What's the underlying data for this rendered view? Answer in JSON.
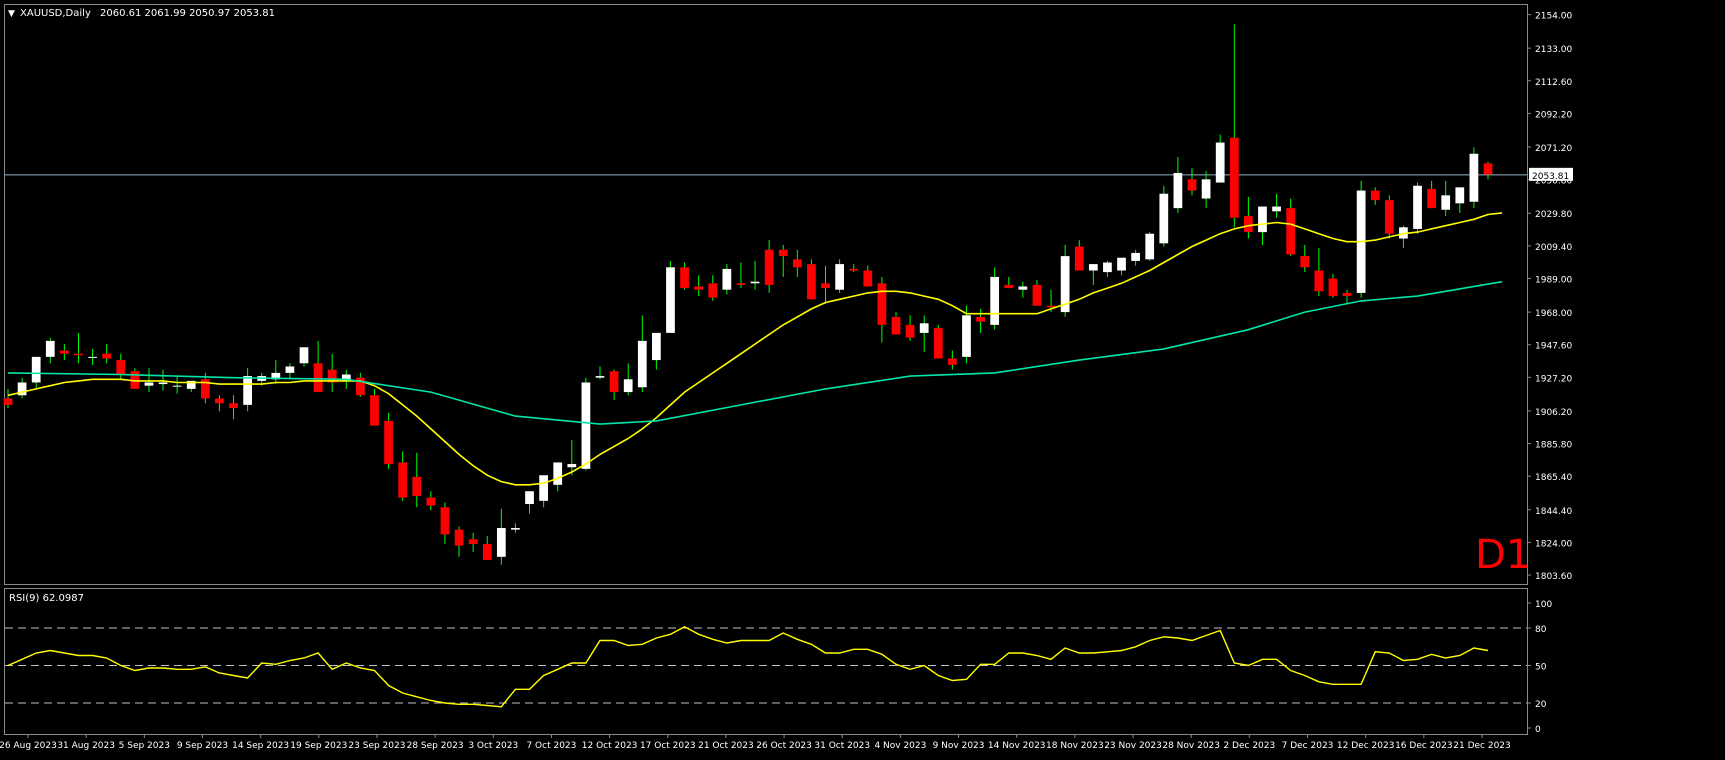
{
  "window": {
    "header_symbol": "XAUUSD,Daily",
    "header_ohlc": "2060.61 2061.99 2050.97 2053.81",
    "timeframe_badge": "D1"
  },
  "colors": {
    "background": "#000000",
    "bull_candle": "#ffffff",
    "bear_candle": "#ff0000",
    "wick": "#00ff00",
    "ma_fast": "#ffff00",
    "ma_slow": "#00e5a8",
    "rsi_line": "#ffff00",
    "price_line": "#8fb3c8",
    "badge": "#ff0000",
    "axis_text": "#ffffff"
  },
  "chart_data": [
    {
      "type": "candlestick",
      "symbol": "XAUUSD",
      "timeframe": "Daily",
      "current_price": 2053.81,
      "y_ticks": [
        "2154.00",
        "2133.00",
        "2112.60",
        "2092.20",
        "2071.20",
        "2050.80",
        "2029.80",
        "2009.40",
        "1989.00",
        "1968.00",
        "1947.60",
        "1927.20",
        "1906.20",
        "1885.80",
        "1865.40",
        "1844.40",
        "1824.00",
        "1803.60"
      ],
      "x_ticks": [
        "26 Aug 2023",
        "31 Aug 2023",
        "5 Sep 2023",
        "9 Sep 2023",
        "14 Sep 2023",
        "19 Sep 2023",
        "23 Sep 2023",
        "28 Sep 2023",
        "3 Oct 2023",
        "7 Oct 2023",
        "12 Oct 2023",
        "17 Oct 2023",
        "21 Oct 2023",
        "26 Oct 2023",
        "31 Oct 2023",
        "4 Nov 2023",
        "9 Nov 2023",
        "14 Nov 2023",
        "18 Nov 2023",
        "23 Nov 2023",
        "28 Nov 2023",
        "2 Dec 2023",
        "7 Dec 2023",
        "12 Dec 2023",
        "16 Dec 2023",
        "21 Dec 2023"
      ],
      "ylim": [
        1798,
        2160
      ],
      "ohlc": [
        [
          1914,
          1920,
          1908,
          1910
        ],
        [
          1916,
          1927,
          1914,
          1924
        ],
        [
          1924,
          1940,
          1920,
          1940
        ],
        [
          1940,
          1952,
          1936,
          1950
        ],
        [
          1944,
          1948,
          1938,
          1942
        ],
        [
          1942,
          1955,
          1936,
          1941
        ],
        [
          1940,
          1945,
          1935,
          1940
        ],
        [
          1942,
          1948,
          1936,
          1939
        ],
        [
          1938,
          1942,
          1926,
          1929
        ],
        [
          1931,
          1933,
          1920,
          1920
        ],
        [
          1922,
          1933,
          1918,
          1924
        ],
        [
          1923,
          1932,
          1919,
          1924
        ],
        [
          1922,
          1928,
          1917,
          1922
        ],
        [
          1920,
          1924,
          1918,
          1925
        ],
        [
          1926,
          1930,
          1911,
          1914
        ],
        [
          1914,
          1916,
          1906,
          1911
        ],
        [
          1911,
          1916,
          1901,
          1908
        ],
        [
          1910,
          1933,
          1906,
          1928
        ],
        [
          1925,
          1930,
          1922,
          1928
        ],
        [
          1926,
          1938,
          1923,
          1930
        ],
        [
          1930,
          1936,
          1926,
          1934
        ],
        [
          1936,
          1945,
          1934,
          1946
        ],
        [
          1936,
          1950,
          1918,
          1918
        ],
        [
          1932,
          1942,
          1918,
          1924
        ],
        [
          1925,
          1932,
          1920,
          1929
        ],
        [
          1927,
          1930,
          1915,
          1916
        ],
        [
          1916,
          1920,
          1897,
          1897
        ],
        [
          1900,
          1905,
          1870,
          1873
        ],
        [
          1874,
          1881,
          1850,
          1852
        ],
        [
          1865,
          1880,
          1846,
          1853
        ],
        [
          1852,
          1856,
          1844,
          1847
        ],
        [
          1846,
          1849,
          1823,
          1829
        ],
        [
          1832,
          1834,
          1815,
          1822
        ],
        [
          1826,
          1830,
          1818,
          1823
        ],
        [
          1823,
          1828,
          1815,
          1813
        ],
        [
          1815,
          1845,
          1810,
          1833
        ],
        [
          1832,
          1836,
          1830,
          1833
        ],
        [
          1848,
          1854,
          1842,
          1856
        ],
        [
          1850,
          1859,
          1846,
          1866
        ],
        [
          1860,
          1872,
          1856,
          1874
        ],
        [
          1871,
          1888,
          1866,
          1873
        ],
        [
          1870,
          1927,
          1869,
          1924
        ],
        [
          1927,
          1934,
          1926,
          1928
        ],
        [
          1931,
          1932,
          1913,
          1918
        ],
        [
          1918,
          1936,
          1916,
          1926
        ],
        [
          1921,
          1966,
          1918,
          1950
        ],
        [
          1938,
          1955,
          1932,
          1955
        ],
        [
          1955,
          2000,
          1955,
          1996
        ],
        [
          1996,
          1999,
          1982,
          1983
        ],
        [
          1984,
          1991,
          1978,
          1982
        ],
        [
          1986,
          1991,
          1975,
          1977
        ],
        [
          1982,
          1998,
          1979,
          1995
        ],
        [
          1986,
          1999,
          1983,
          1985
        ],
        [
          1986,
          2000,
          1982,
          1987
        ],
        [
          2007,
          2013,
          1980,
          1985
        ],
        [
          2007,
          2010,
          1990,
          2003
        ],
        [
          2001,
          2007,
          1990,
          1996
        ],
        [
          1998,
          2001,
          1977,
          1976
        ],
        [
          1986,
          1997,
          1973,
          1983
        ],
        [
          1982,
          2001,
          1980,
          1998
        ],
        [
          1995,
          1998,
          1993,
          1994
        ],
        [
          1994,
          1997,
          1985,
          1984
        ],
        [
          1986,
          1990,
          1949,
          1960
        ],
        [
          1965,
          1968,
          1954,
          1954
        ],
        [
          1960,
          1966,
          1950,
          1952
        ],
        [
          1955,
          1966,
          1943,
          1961
        ],
        [
          1958,
          1960,
          1939,
          1939
        ],
        [
          1939,
          1944,
          1932,
          1935
        ],
        [
          1940,
          1972,
          1936,
          1966
        ],
        [
          1965,
          1970,
          1955,
          1962
        ],
        [
          1960,
          1996,
          1957,
          1990
        ],
        [
          1985,
          1990,
          1983,
          1983
        ],
        [
          1982,
          1987,
          1977,
          1984
        ],
        [
          1985,
          1988,
          1978,
          1972
        ],
        [
          1972,
          1982,
          1968,
          1971
        ],
        [
          1968,
          2010,
          1965,
          2003
        ],
        [
          2009,
          2013,
          1996,
          1994
        ],
        [
          1994,
          1998,
          1985,
          1998
        ],
        [
          1993,
          2000,
          1990,
          1999
        ],
        [
          1994,
          2001,
          1991,
          2002
        ],
        [
          2000,
          2007,
          1997,
          2005
        ],
        [
          2001,
          2018,
          2000,
          2017
        ],
        [
          2011,
          2047,
          2009,
          2042
        ],
        [
          2033,
          2065,
          2030,
          2055
        ],
        [
          2051,
          2058,
          2041,
          2044
        ],
        [
          2039,
          2056,
          2033,
          2051
        ],
        [
          2049,
          2079,
          2049,
          2074
        ],
        [
          2077,
          2148,
          2021,
          2027
        ],
        [
          2028,
          2040,
          2014,
          2018
        ],
        [
          2018,
          2031,
          2010,
          2034
        ],
        [
          2031,
          2042,
          2027,
          2034
        ],
        [
          2033,
          2039,
          2003,
          2004
        ],
        [
          2003,
          2010,
          1993,
          1996
        ],
        [
          1994,
          2008,
          1978,
          1981
        ],
        [
          1989,
          1992,
          1977,
          1978
        ],
        [
          1980,
          1982,
          1973,
          1978
        ],
        [
          1980,
          2050,
          1977,
          2044
        ],
        [
          2044,
          2046,
          2035,
          2038
        ],
        [
          2038,
          2041,
          2014,
          2017
        ],
        [
          2014,
          2022,
          2008,
          2021
        ],
        [
          2020,
          2049,
          2017,
          2047
        ],
        [
          2045,
          2050,
          2033,
          2033
        ],
        [
          2032,
          2050,
          2028,
          2041
        ],
        [
          2036,
          2042,
          2030,
          2046
        ],
        [
          2037,
          2071,
          2033,
          2067
        ],
        [
          2061,
          2062,
          2051,
          2054
        ]
      ],
      "ma_fast_values": [
        1916,
        1918,
        1920,
        1922,
        1924,
        1925,
        1926,
        1926,
        1926,
        1925,
        1925,
        1925,
        1924,
        1924,
        1924,
        1923,
        1923,
        1923,
        1923,
        1924,
        1924,
        1925,
        1925,
        1925,
        1925,
        1925,
        1922,
        1917,
        1910,
        1903,
        1895,
        1887,
        1879,
        1872,
        1866,
        1862,
        1860,
        1860,
        1861,
        1864,
        1868,
        1873,
        1879,
        1884,
        1889,
        1895,
        1902,
        1910,
        1918,
        1924,
        1930,
        1936,
        1942,
        1948,
        1954,
        1960,
        1965,
        1970,
        1974,
        1976,
        1978,
        1980,
        1981,
        1981,
        1980,
        1978,
        1976,
        1972,
        1967,
        1967,
        1967,
        1967,
        1967,
        1967,
        1970,
        1973,
        1976,
        1980,
        1983,
        1986,
        1990,
        1994,
        1999,
        2004,
        2009,
        2013,
        2017,
        2020,
        2022,
        2023,
        2024,
        2023,
        2020,
        2017,
        2014,
        2012,
        2012,
        2013,
        2015,
        2017,
        2018,
        2020,
        2022,
        2024,
        2026,
        2029,
        2030
      ]
    },
    {
      "type": "line",
      "name": "RSI(9)",
      "header": "RSI(9) 62.0987",
      "y_ticks": [
        "100",
        "80",
        "50",
        "20",
        "0"
      ],
      "levels": [
        80,
        50,
        20
      ],
      "ylim": [
        0,
        100
      ],
      "values": [
        50,
        55,
        60,
        62,
        60,
        58,
        58,
        56,
        50,
        46,
        48,
        48,
        47,
        47,
        49,
        44,
        42,
        40,
        52,
        51,
        54,
        56,
        60,
        47,
        52,
        48,
        46,
        34,
        28,
        25,
        22,
        20,
        19,
        19,
        18,
        17,
        31,
        31,
        42,
        47,
        52,
        52,
        70,
        70,
        66,
        67,
        72,
        75,
        81,
        75,
        71,
        68,
        70,
        70,
        70,
        76,
        71,
        67,
        60,
        60,
        63,
        63,
        59,
        51,
        47,
        50,
        42,
        38,
        39,
        51,
        51,
        60,
        60,
        58,
        55,
        64,
        60,
        60,
        61,
        62,
        65,
        70,
        73,
        72,
        70,
        74,
        78,
        52,
        50,
        55,
        55,
        46,
        42,
        37,
        35,
        35,
        35,
        61,
        60,
        54,
        55,
        59,
        56,
        58,
        64,
        62
      ]
    }
  ]
}
